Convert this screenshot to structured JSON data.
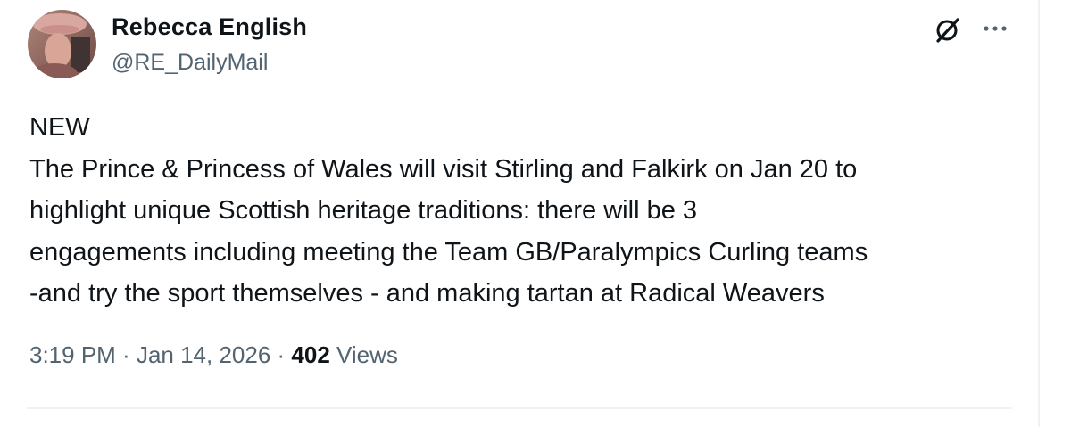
{
  "author": {
    "display_name": "Rebecca English",
    "handle": "@RE_DailyMail"
  },
  "header_icons": {
    "grok": "grok-icon",
    "more": "more-icon"
  },
  "tweet": {
    "text": "NEW\nThe Prince & Princess of Wales will visit Stirling and Falkirk on Jan 20 to\nhighlight unique Scottish heritage traditions: there will be 3\nengagements including meeting the Team GB/Paralympics Curling teams\n-and try the sport themselves - and making tartan at Radical Weavers"
  },
  "meta": {
    "time": "3:19 PM",
    "separator": " · ",
    "date": "Jan 14, 2026",
    "views_count": "402",
    "views_label": " Views"
  },
  "colors": {
    "text_primary": "#0f1419",
    "text_secondary": "#536471",
    "divider": "#eff3f4"
  }
}
